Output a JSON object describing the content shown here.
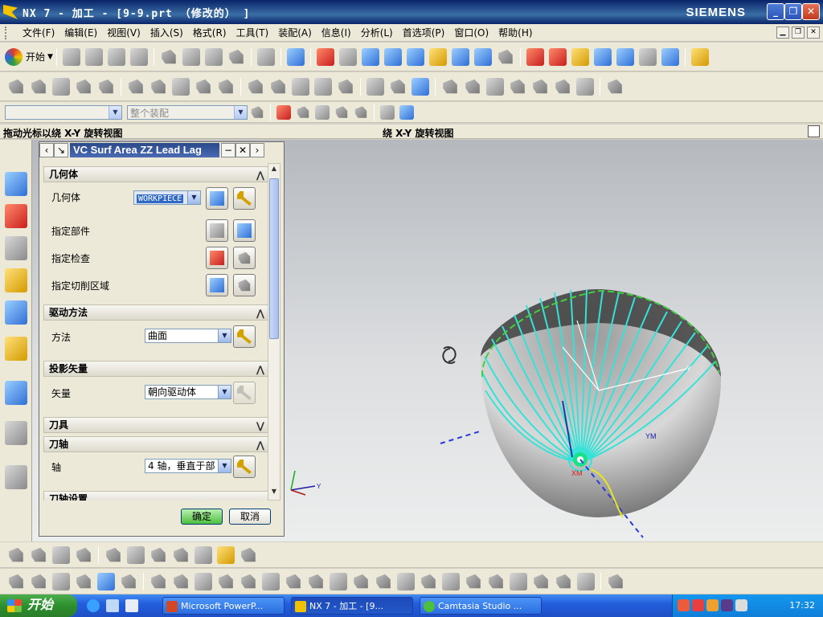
{
  "window": {
    "title": "NX 7 - 加工 - [9-9.prt （修改的） ]",
    "brand": "SIEMENS",
    "controls": {
      "minimize": "_",
      "restore": "❐",
      "close": "✕"
    }
  },
  "menubar": {
    "items": [
      "文件(F)",
      "编辑(E)",
      "视图(V)",
      "插入(S)",
      "格式(R)",
      "工具(T)",
      "装配(A)",
      "信息(I)",
      "分析(L)",
      "首选项(P)",
      "窗口(O)",
      "帮助(H)"
    ]
  },
  "toolbar": {
    "start_label": "开始",
    "filter_combo": "",
    "assembly_combo": "整个装配"
  },
  "cueline": {
    "cue": "拖动光标以绕 X-Y 旋转视图",
    "status": "绕 X-Y 旋转视图"
  },
  "dialog": {
    "title": "VC Surf Area ZZ Lead Lag",
    "sections": {
      "geometry": {
        "header": "几何体",
        "geometry_label": "几何体",
        "geometry_value": "WORKPIECE",
        "part_label": "指定部件",
        "check_label": "指定检查",
        "cut_area_label": "指定切削区域"
      },
      "drive": {
        "header": "驱动方法",
        "method_label": "方法",
        "method_value": "曲面"
      },
      "projection": {
        "header": "投影矢量",
        "vector_label": "矢量",
        "vector_value": "朝向驱动体"
      },
      "tool": {
        "header": "刀具"
      },
      "tool_axis": {
        "header": "刀轴",
        "axis_label": "轴",
        "axis_value": "4 轴，垂直于部"
      },
      "tool_axis_settings": {
        "header": "刀轴设置"
      }
    },
    "ok_label": "确定",
    "cancel_label": "取消"
  },
  "viewport": {
    "axis_labels": {
      "x": "X",
      "y": "Y",
      "xm": "XM",
      "ym": "YM"
    }
  },
  "taskbar": {
    "start_label": "开始",
    "tasks": [
      "Microsoft PowerP...",
      "NX 7 - 加工 - [9...",
      "Camtasia Studio ..."
    ],
    "clock": "17:32"
  },
  "colors": {
    "toolpath": "#33e3d8",
    "dialog_title": "#2a4a8a",
    "taskbar": "#245edb",
    "start_green": "#2d8f2d"
  }
}
